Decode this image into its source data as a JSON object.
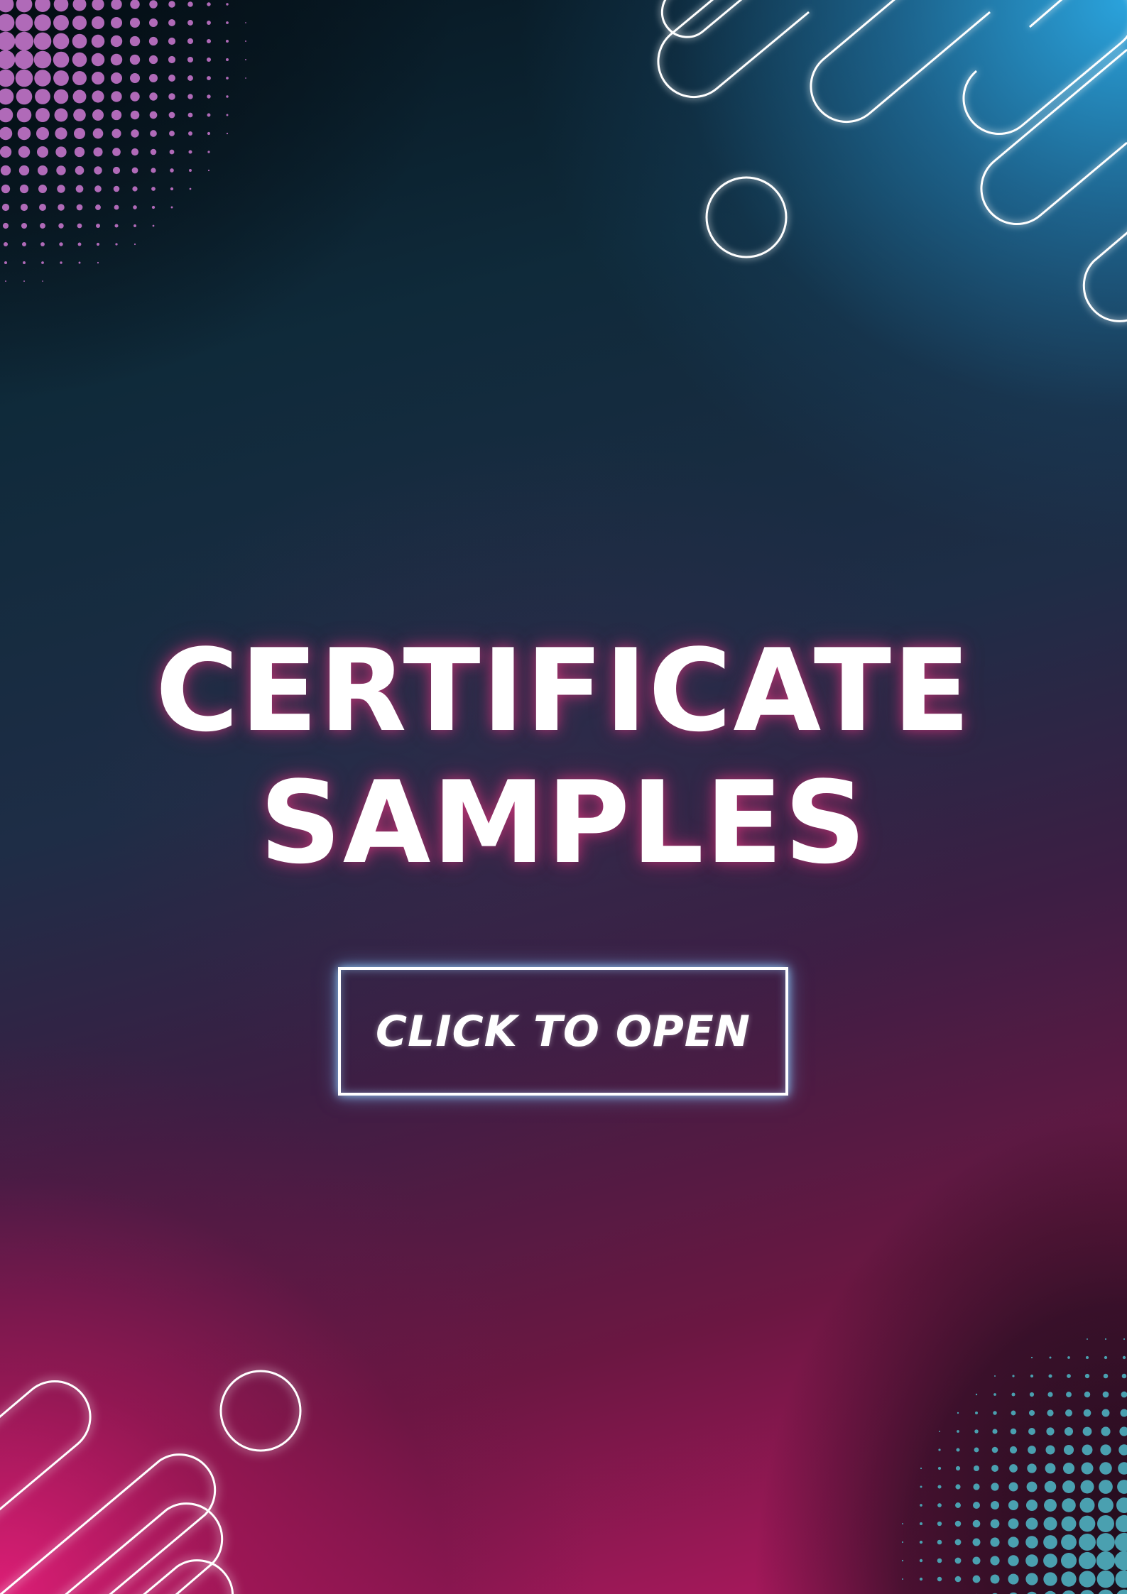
{
  "page": {
    "title_line1": "CERTIFICATE",
    "title_line2": "SAMPLES",
    "cta_label": "CLICK TO OPEN"
  },
  "colors": {
    "accent_blue": "#2caae6",
    "accent_pink": "#e11e78",
    "halftone_purple": "#b06ab8",
    "halftone_teal": "#4aa0b0",
    "neon_outline": "#ffffff",
    "text": "#ffffff"
  },
  "decorations": {
    "top_left": "halftone-dot-pattern",
    "top_right": "neon-pill-outlines",
    "bottom_left": "neon-pill-outlines",
    "bottom_right": "halftone-dot-pattern"
  }
}
